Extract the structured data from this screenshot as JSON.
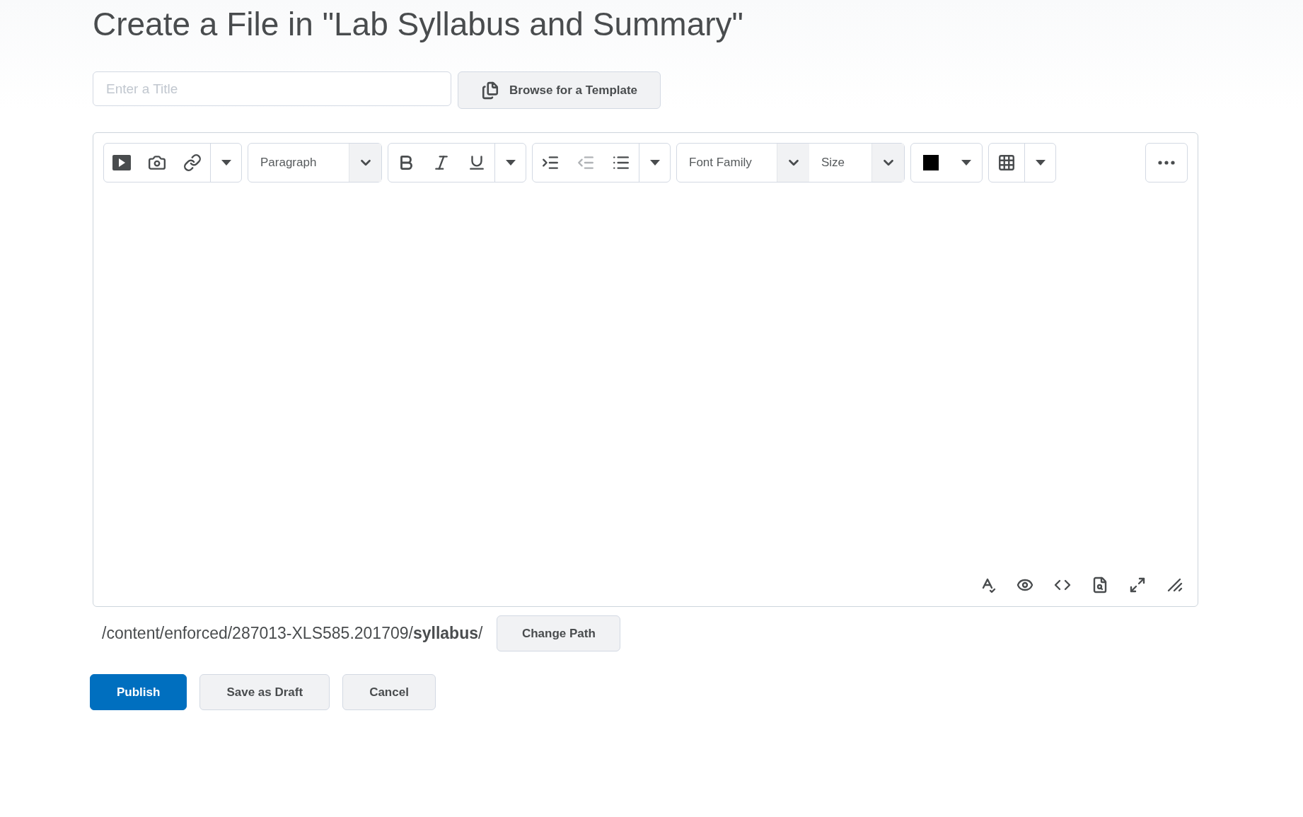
{
  "heading": "Create a File in \"Lab Syllabus and Summary\"",
  "title_field": {
    "placeholder": "Enter a Title"
  },
  "template_button": "Browse for a Template",
  "toolbar": {
    "format_select": "Paragraph",
    "font_family_select": "Font Family",
    "size_select": "Size",
    "list_buttons": [
      {
        "disabled": false
      },
      {
        "disabled": true
      },
      {
        "disabled": false
      }
    ]
  },
  "path": "/content/enforced/287013-XLS585.201709/**syllabus**/",
  "change_path_button": "Change Path",
  "actions": [
    {
      "label": "Publish",
      "kind": "primary"
    },
    {
      "label": "Save as Draft",
      "kind": "secondary"
    },
    {
      "label": "Cancel",
      "kind": "secondary"
    }
  ]
}
